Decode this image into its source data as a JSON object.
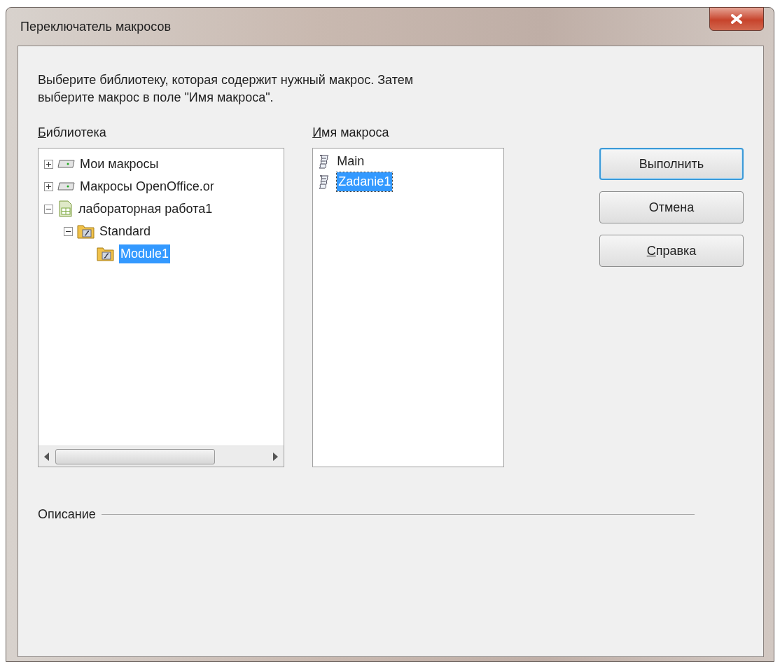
{
  "window": {
    "title": "Переключатель макросов"
  },
  "instructions": "Выберите библиотеку, которая содержит нужный макрос. Затем выберите макрос в поле \"Имя макроса\".",
  "library": {
    "label": "Библиотека",
    "underlined_key": true,
    "tree": [
      {
        "label": "Мои макросы",
        "kind": "drive",
        "expanded": false,
        "selected": false
      },
      {
        "label": "Макросы OpenOffice.or",
        "kind": "drive",
        "expanded": false,
        "selected": false
      },
      {
        "label": "лабораторная работа1",
        "kind": "document",
        "expanded": true,
        "selected": false,
        "children": [
          {
            "label": "Standard",
            "kind": "library",
            "expanded": true,
            "selected": false,
            "children": [
              {
                "label": "Module1",
                "kind": "module",
                "selected": true
              }
            ]
          }
        ]
      }
    ]
  },
  "macro_name": {
    "label": "Имя макроса",
    "underlined_key": true,
    "items": [
      {
        "label": "Main",
        "selected": false
      },
      {
        "label": "Zadanie1",
        "selected": true
      }
    ]
  },
  "buttons": [
    {
      "label": "Выполнить",
      "default": true
    },
    {
      "label": "Отмена",
      "default": false
    },
    {
      "label": "Справка",
      "underlined_key": true,
      "default": false
    }
  ],
  "description": {
    "label": "Описание"
  }
}
